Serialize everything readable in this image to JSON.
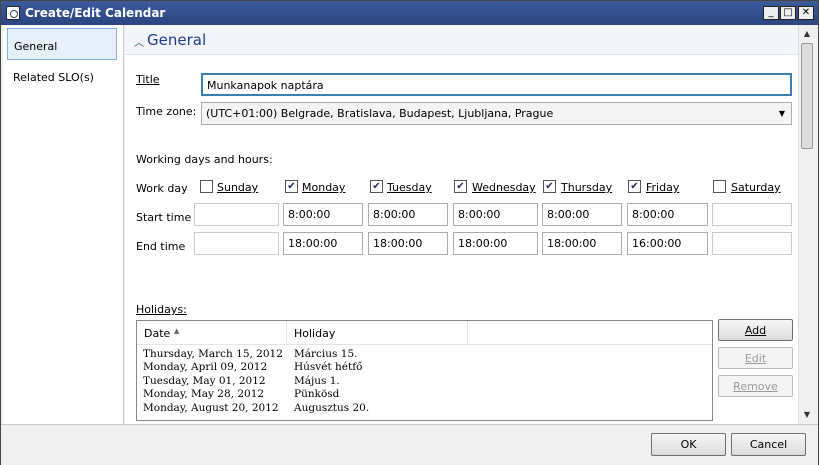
{
  "window": {
    "title": "Create/Edit Calendar"
  },
  "nav": {
    "items": [
      {
        "label": "General"
      },
      {
        "label": "Related SLO(s)"
      }
    ]
  },
  "section": {
    "title": "General"
  },
  "form": {
    "title_label": "Title",
    "title_value": "Munkanapok naptára",
    "timezone_label": "Time zone:",
    "timezone_value": "(UTC+01:00) Belgrade, Bratislava, Budapest, Ljubljana, Prague",
    "working_days_label": "Working days and hours:",
    "work_day_label": "Work day",
    "start_time_label": "Start time",
    "end_time_label": "End time",
    "days": [
      {
        "name": "Sunday",
        "checked": false,
        "start": "",
        "end": ""
      },
      {
        "name": "Monday",
        "checked": true,
        "start": "8:00:00",
        "end": "18:00:00"
      },
      {
        "name": "Tuesday",
        "checked": true,
        "start": "8:00:00",
        "end": "18:00:00"
      },
      {
        "name": "Wednesday",
        "checked": true,
        "start": "8:00:00",
        "end": "18:00:00"
      },
      {
        "name": "Thursday",
        "checked": true,
        "start": "8:00:00",
        "end": "18:00:00"
      },
      {
        "name": "Friday",
        "checked": true,
        "start": "8:00:00",
        "end": "16:00:00"
      },
      {
        "name": "Saturday",
        "checked": false,
        "start": "",
        "end": ""
      }
    ]
  },
  "holidays": {
    "label": "Holidays:",
    "columns": [
      "Date",
      "Holiday"
    ],
    "rows": [
      {
        "date": "Thursday, March 15, 2012",
        "holiday": "Március 15."
      },
      {
        "date": "Monday, April 09, 2012",
        "holiday": "Húsvét hétfő"
      },
      {
        "date": "Tuesday, May 01, 2012",
        "holiday": "Május 1."
      },
      {
        "date": "Monday, May 28, 2012",
        "holiday": "Pünkösd"
      },
      {
        "date": "Monday, August 20, 2012",
        "holiday": "Augusztus 20."
      }
    ],
    "add_label": "Add",
    "edit_label": "Edit",
    "remove_label": "Remove"
  },
  "footer": {
    "ok_label": "OK",
    "cancel_label": "Cancel"
  }
}
